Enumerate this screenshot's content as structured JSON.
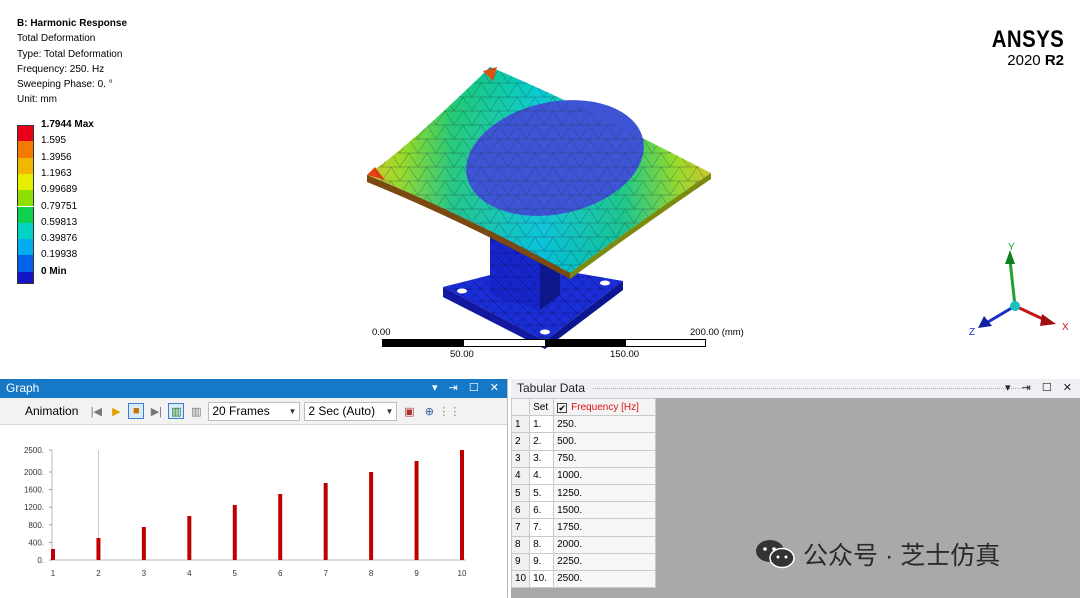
{
  "result": {
    "title": "B: Harmonic Response",
    "line1": "Total Deformation",
    "line2": "Type: Total Deformation",
    "line3": "Frequency: 250. Hz",
    "line4": "Sweeping Phase: 0. °",
    "line5": "Unit: mm"
  },
  "legend": [
    {
      "label": "1.7944 Max",
      "color": "#e8001b"
    },
    {
      "label": "1.595",
      "color": "#f47a00"
    },
    {
      "label": "1.3956",
      "color": "#f2b800"
    },
    {
      "label": "1.1963",
      "color": "#e6ee00"
    },
    {
      "label": "0.99689",
      "color": "#8edf00"
    },
    {
      "label": "0.79751",
      "color": "#10d050"
    },
    {
      "label": "0.59813",
      "color": "#00d3c4"
    },
    {
      "label": "0.39876",
      "color": "#00aef0"
    },
    {
      "label": "0.19938",
      "color": "#0063e8"
    },
    {
      "label": "0 Min",
      "color": "#1515c8"
    }
  ],
  "brand": {
    "name": "ANSYS",
    "version": "2020",
    "release": "R2"
  },
  "scale": {
    "start": "0.00",
    "end": "200.00 (mm)",
    "mid1": "50.00",
    "mid2": "150.00"
  },
  "triad": {
    "y": "Y",
    "x": "X",
    "z": "Z"
  },
  "graph_panel": {
    "title": "Graph",
    "buttons": "▾ ⇥ ☐ ✕"
  },
  "animation": {
    "label": "Animation",
    "frames": "20 Frames",
    "duration": "2 Sec (Auto)"
  },
  "table_panel": {
    "title": "Tabular Data",
    "buttons": "▾ ⇥ ☐ ✕"
  },
  "table": {
    "header_set": "Set",
    "header_freq": "Frequency [Hz]",
    "rows": [
      {
        "n": "1",
        "set": "1.",
        "freq": "250."
      },
      {
        "n": "2",
        "set": "2.",
        "freq": "500."
      },
      {
        "n": "3",
        "set": "3.",
        "freq": "750."
      },
      {
        "n": "4",
        "set": "4.",
        "freq": "1000."
      },
      {
        "n": "5",
        "set": "5.",
        "freq": "1250."
      },
      {
        "n": "6",
        "set": "6.",
        "freq": "1500."
      },
      {
        "n": "7",
        "set": "7.",
        "freq": "1750."
      },
      {
        "n": "8",
        "set": "8.",
        "freq": "2000."
      },
      {
        "n": "9",
        "set": "9.",
        "freq": "2250."
      },
      {
        "n": "10",
        "set": "10.",
        "freq": "2500."
      }
    ]
  },
  "chart_data": {
    "type": "bar",
    "categories": [
      "1",
      "2",
      "3",
      "4",
      "5",
      "6",
      "7",
      "8",
      "9",
      "10"
    ],
    "values": [
      250,
      500,
      750,
      1000,
      1250,
      1500,
      1750,
      2000,
      2250,
      2500
    ],
    "yticks": [
      "0.",
      "400.",
      "800.",
      "1200.",
      "1600.",
      "2000.",
      "2500."
    ],
    "ylim": [
      0,
      2500
    ],
    "bar_color": "#c00000",
    "title": "",
    "xlabel": "",
    "ylabel": ""
  },
  "watermark": {
    "text": "公众号 · 芝士仿真"
  }
}
